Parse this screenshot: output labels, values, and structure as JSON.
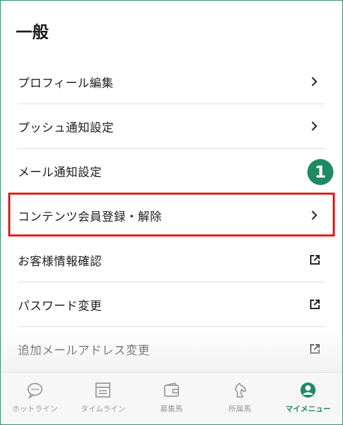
{
  "section": {
    "title": "一般"
  },
  "menu": {
    "items": [
      {
        "label": "プロフィール編集",
        "icon": "chevron-right-icon"
      },
      {
        "label": "プッシュ通知設定",
        "icon": "chevron-right-icon"
      },
      {
        "label": "メール通知設定",
        "icon": "chevron-right-icon"
      },
      {
        "label": "コンテンツ会員登録・解除",
        "icon": "chevron-right-icon"
      },
      {
        "label": "お客様情報確認",
        "icon": "external-link-icon"
      },
      {
        "label": "パスワード変更",
        "icon": "external-link-icon"
      },
      {
        "label": "追加メールアドレス変更",
        "icon": "external-link-icon"
      }
    ]
  },
  "annotation": {
    "badge": "1"
  },
  "tabs": [
    {
      "label": "ホットライン",
      "icon": "chat-bubble-icon"
    },
    {
      "label": "タイムライン",
      "icon": "timeline-icon"
    },
    {
      "label": "募集馬",
      "icon": "wallet-icon"
    },
    {
      "label": "所属馬",
      "icon": "horse-icon"
    },
    {
      "label": "マイメニュー",
      "icon": "user-icon",
      "active": true
    }
  ],
  "colors": {
    "accent": "#1f8a62",
    "highlight": "#e01e1e"
  }
}
